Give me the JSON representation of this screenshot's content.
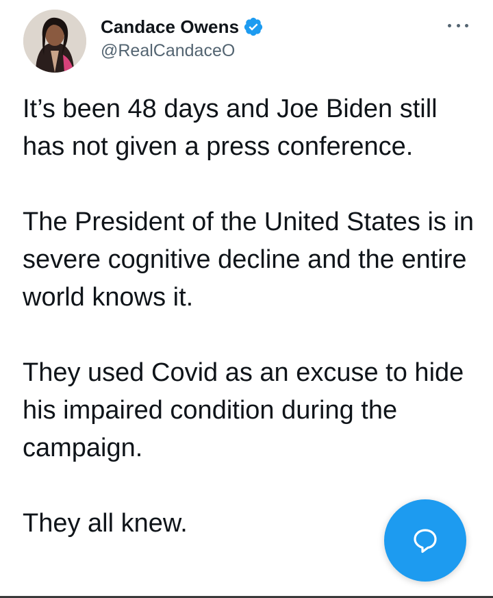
{
  "author": {
    "display_name": "Candace Owens",
    "handle": "@RealCandaceO",
    "verified": true
  },
  "icons": {
    "avatar": "profile-photo",
    "verified": "verified-badge-icon",
    "more": "more-options-icon",
    "compose": "reply-bubble-icon"
  },
  "tweet": {
    "paragraphs": [
      "It’s been 48 days and Joe Biden still has not given a press conference.",
      "The President of the United States is in severe cognitive decline and the entire world knows it.",
      "They used Covid as an excuse to hide his impaired condition during the campaign.",
      "They all knew."
    ]
  },
  "colors": {
    "accent": "#1d9bf0",
    "text_primary": "#0f1419",
    "text_secondary": "#536471"
  }
}
